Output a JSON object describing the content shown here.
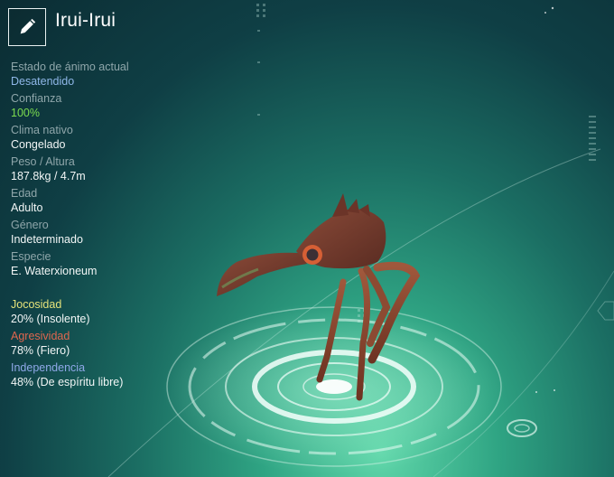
{
  "header": {
    "edit_icon": "pencil-icon",
    "title": "Irui-Irui"
  },
  "stats": [
    {
      "label": "Estado de ánimo actual",
      "value": "Desatendido",
      "value_color": "#8fb7e8"
    },
    {
      "label": "Confianza",
      "value": "100%",
      "value_color": "#7cdc4f"
    },
    {
      "label": "Clima nativo",
      "value": "Congelado",
      "value_color": "#f2f6f6"
    },
    {
      "label": "Peso / Altura",
      "value": "187.8kg / 4.7m",
      "value_color": "#f2f6f6"
    },
    {
      "label": "Edad",
      "value": "Adulto",
      "value_color": "#f2f6f6"
    },
    {
      "label": "Género",
      "value": "Indeterminado",
      "value_color": "#f2f6f6"
    },
    {
      "label": "Especie",
      "value": "E. Waterxioneum",
      "value_color": "#f2f6f6"
    }
  ],
  "traits": [
    {
      "label": "Jocosidad",
      "value": "20% (Insolente)",
      "label_color": "#e6e37a"
    },
    {
      "label": "Agresividad",
      "value": "78% (Fiero)",
      "label_color": "#e0664e"
    },
    {
      "label": "Independencia",
      "value": "48% (De espíritu libre)",
      "label_color": "#8fa8e8"
    }
  ]
}
